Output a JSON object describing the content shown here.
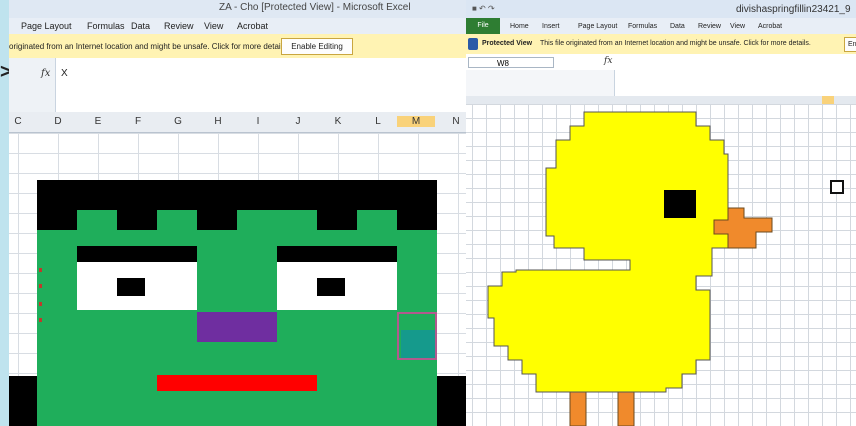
{
  "left": {
    "title": "ZA - Cho [Protected View] - Microsoft Excel",
    "ribbon_tabs": [
      "Page Layout",
      "Formulas",
      "Data",
      "Review",
      "View",
      "Acrobat"
    ],
    "message": "originated from an Internet location and might be unsafe. Click for more details.",
    "enable_button": "Enable Editing",
    "fx": "fx",
    "formula_value": "X",
    "columns": [
      "C",
      "D",
      "E",
      "F",
      "G",
      "H",
      "I",
      "J",
      "K",
      "L",
      "M",
      "N"
    ],
    "selected_column": "M"
  },
  "right": {
    "title": "divishaspringfillin23421_9",
    "quick_access": "■ ↶ ↷",
    "ribbon_tabs": [
      "File",
      "Home",
      "Insert",
      "Page Layout",
      "Formulas",
      "Data",
      "Review",
      "View",
      "Acrobat"
    ],
    "protected_label": "Protected View",
    "message": "This file originated from an Internet location and might be unsafe. Click for more details.",
    "enable_button": "Ena",
    "name_box": "W8",
    "fx": "fx"
  },
  "colors": {
    "frank_green": "#1fae5b",
    "black": "#000000",
    "purple": "#6f2ea0",
    "red": "#ff0000",
    "duck_yellow": "#ffff00",
    "duck_orange": "#f08a2c"
  }
}
